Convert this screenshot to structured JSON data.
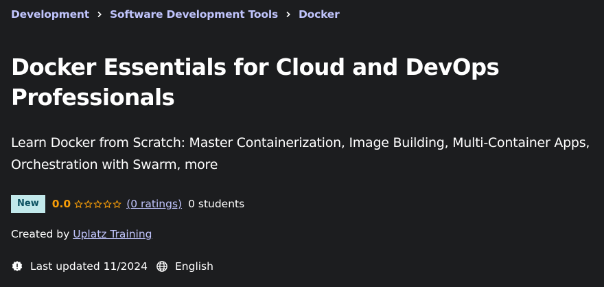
{
  "breadcrumb": {
    "items": [
      "Development",
      "Software Development Tools",
      "Docker"
    ]
  },
  "course": {
    "title": "Docker Essentials for Cloud and DevOps Professionals",
    "subtitle": "Learn Docker from Scratch: Master Containerization, Image Building, Multi-Container Apps, Orchestration with Swarm, more",
    "badge": "New",
    "rating": "0.0",
    "stars_filled": 0,
    "stars_total": 5,
    "ratings_link": "(0 ratings)",
    "students": "0 students",
    "created_by_label": "Created by",
    "instructor": "Uplatz Training",
    "last_updated": "Last updated 11/2024",
    "language": "English"
  },
  "icons": {
    "breadcrumb_separator": "chevron-right-icon",
    "updated": "alert-badge-icon",
    "language": "globe-icon",
    "star": "star-outline-icon"
  },
  "colors": {
    "background": "#1c1d1f",
    "link": "#c0c4fc",
    "rating": "#f69c08",
    "badge_bg": "#c2e9eb",
    "badge_text": "#0d5261"
  }
}
